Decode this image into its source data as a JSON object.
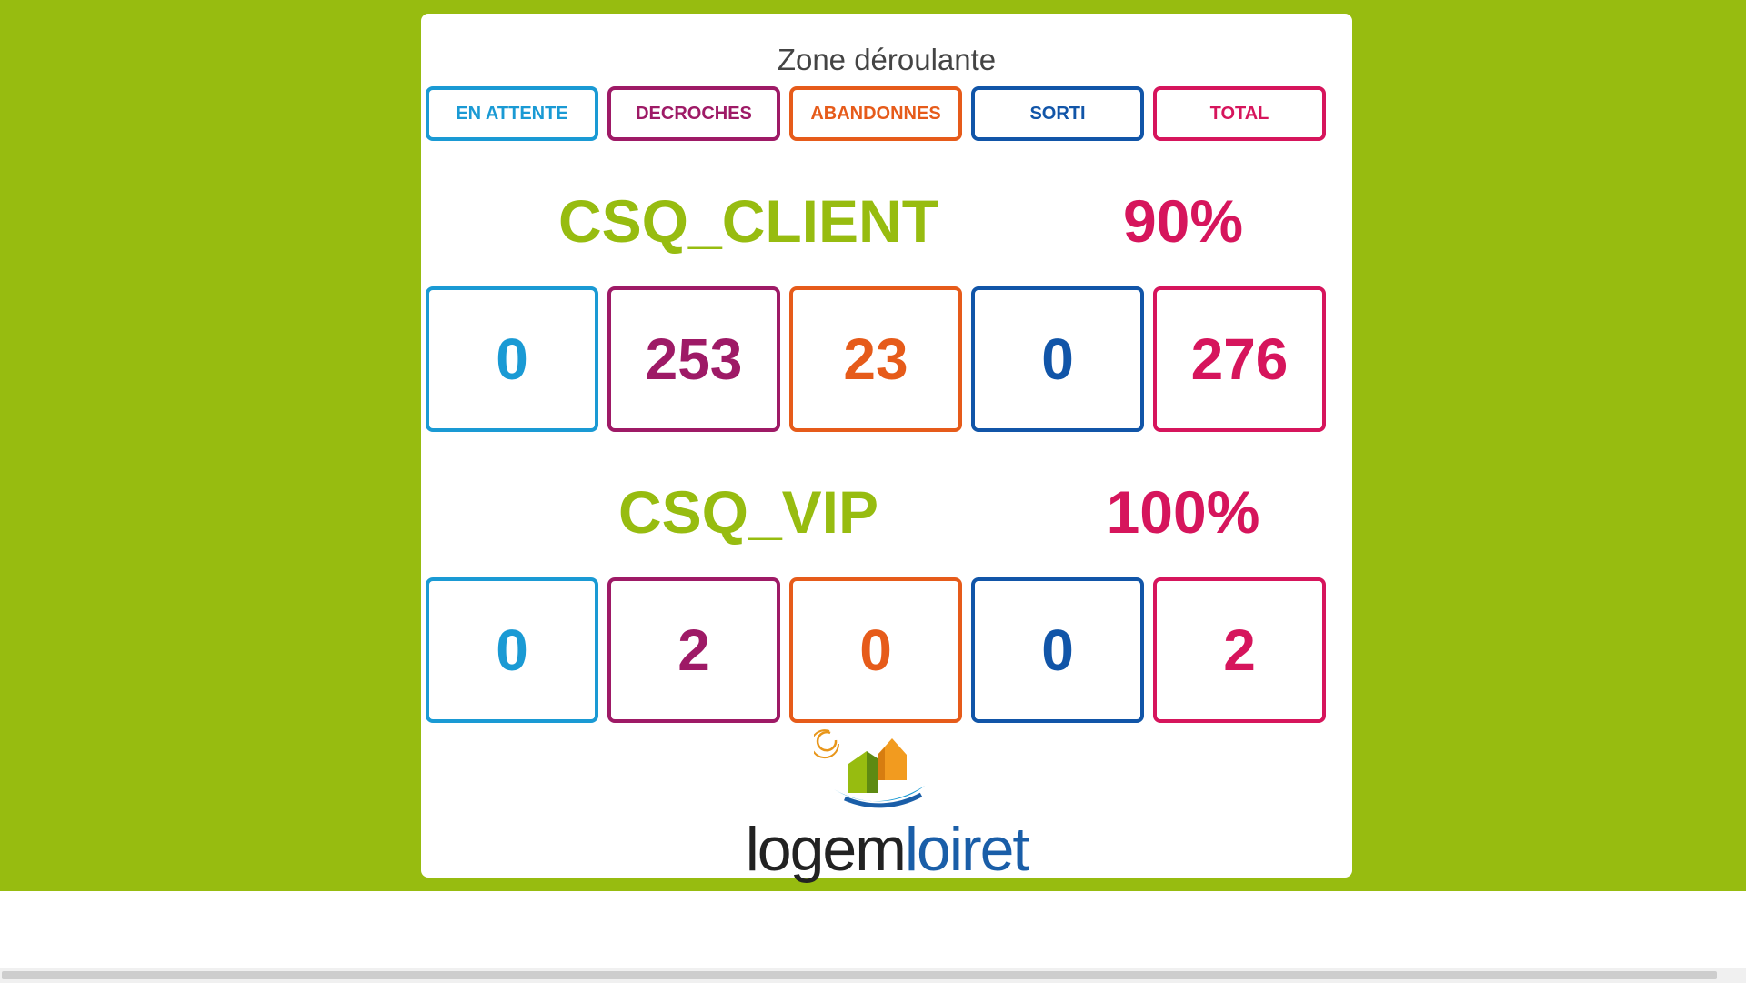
{
  "title": "Zone déroulante",
  "headers": {
    "en_attente": "EN ATTENTE",
    "decroches": "DECROCHES",
    "abandonnes": "ABANDONNES",
    "sorti": "SORTI",
    "total": "TOTAL"
  },
  "queues": [
    {
      "name": "CSQ_CLIENT",
      "percent": "90%",
      "en_attente": "0",
      "decroches": "253",
      "abandonnes": "23",
      "sorti": "0",
      "total": "276"
    },
    {
      "name": "CSQ_VIP",
      "percent": "100%",
      "en_attente": "0",
      "decroches": "2",
      "abandonnes": "0",
      "sorti": "0",
      "total": "2"
    }
  ],
  "logo": {
    "part1": "logem",
    "part2": "loiret"
  },
  "colors": {
    "background": "#97bc10",
    "en_attente": "#1a9ad4",
    "decroches": "#9e1a66",
    "abandonnes": "#e65b1a",
    "sorti": "#1155a8",
    "total": "#d6155c"
  }
}
